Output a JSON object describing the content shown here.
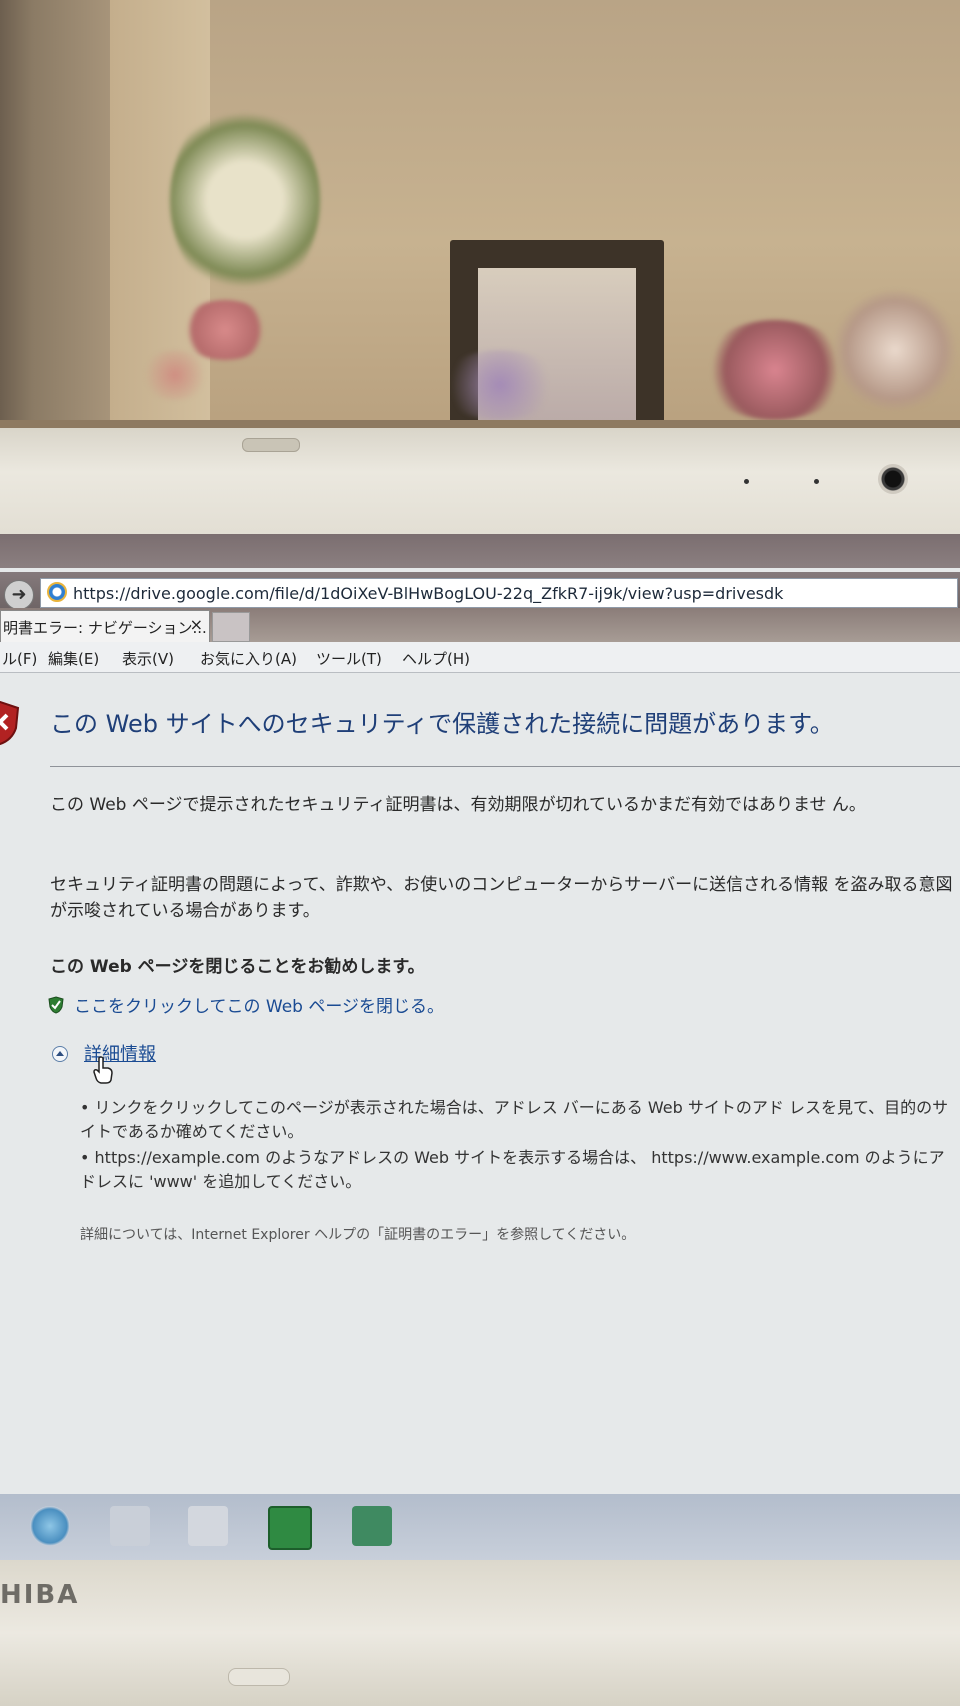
{
  "browser": {
    "url": "https://drive.google.com/file/d/1dOiXeV-BlHwBogLOU-22q_ZfkR7-ij9k/view?usp=drivesdk",
    "tab_title": "明書エラー: ナビゲーション...",
    "tab_close": "×"
  },
  "menu": {
    "items": [
      "ル(F)",
      "編集(E)",
      "表示(V)",
      "お気に入り(A)",
      "ツール(T)",
      "ヘルプ(H)"
    ]
  },
  "error_page": {
    "title": "この Web サイトへのセキュリティで保護された接続に問題があります。",
    "para1": "この Web ページで提示されたセキュリティ証明書は、有効期限が切れているかまだ有効ではありませ ん。",
    "para2": "セキュリティ証明書の問題によって、詐欺や、お使いのコンピューターからサーバーに送信される情報 を盗み取る意図が示唆されている場合があります。",
    "recommendation": "この Web ページを閉じることをお勧めします。",
    "close_link": "ここをクリックしてこの Web ページを閉じる。",
    "more_info": "詳細情報",
    "bullets": [
      "•  リンクをクリックしてこのページが表示された場合は、アドレス バーにある Web サイトのアド レスを見て、目的のサイトであるか確めてください。",
      "•  https://example.com のようなアドレスの Web サイトを表示する場合は、 https://www.example.com のようにアドレスに 'www' を追加してください。"
    ],
    "help_note": "詳細については、Internet Explorer ヘルプの「証明書のエラー」を参照してください。"
  },
  "laptop": {
    "brand": "HIBA"
  },
  "icons": {
    "nav": "arrow-right-icon",
    "browser": "ie-icon",
    "error": "security-shield-icon",
    "close_link": "green-shield-icon",
    "more_info": "collapse-icon",
    "pointer": "hand-cursor-icon"
  },
  "colors": {
    "title_blue": "#1f3f78",
    "link_blue": "#1a4b93",
    "error_red": "#b22222",
    "page_bg": "#e6e9ea"
  }
}
